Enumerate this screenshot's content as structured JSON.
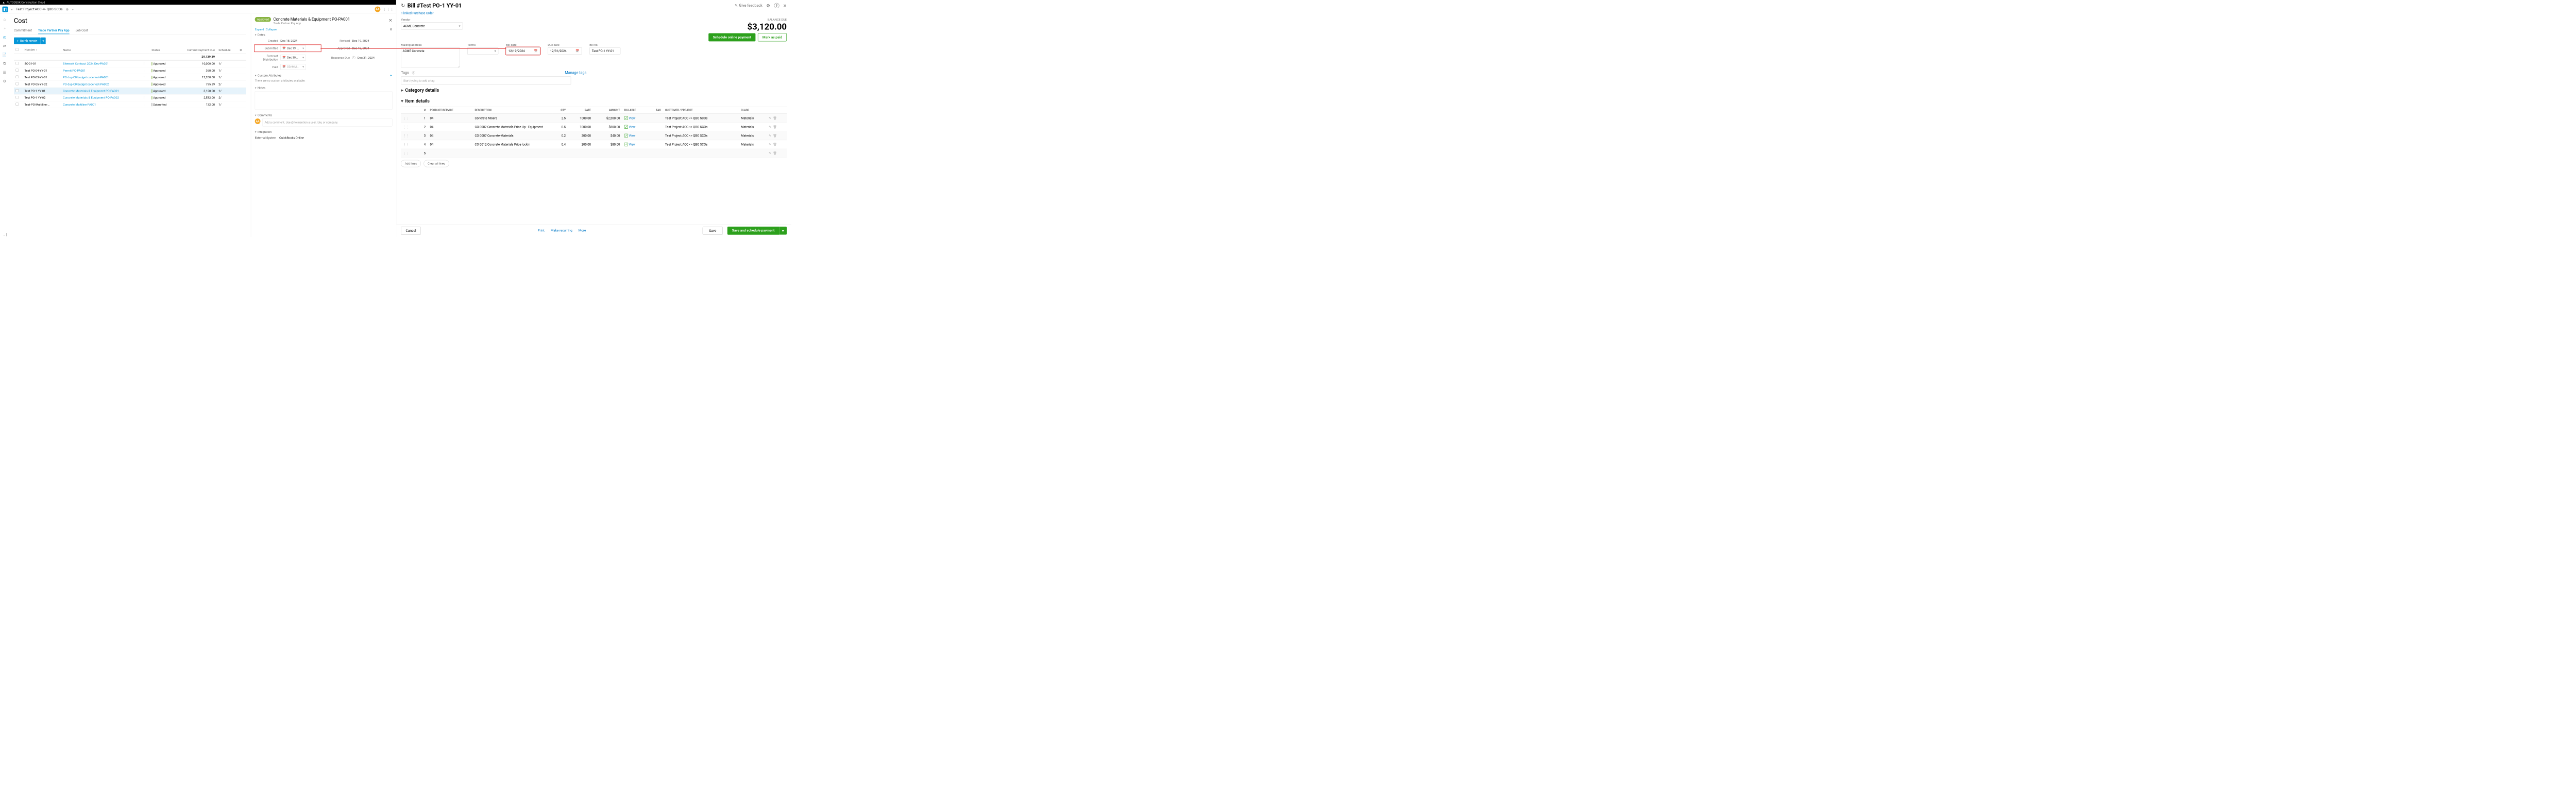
{
  "autodesk": {
    "brand": "AUTODESK Construction Cloud",
    "project_name": "Test Project:ACC <> QBO SCOs",
    "avatar": "AA",
    "page_title": "Cost",
    "tabs": [
      "Commitment",
      "Trade Partner Pay App",
      "Job Cost"
    ],
    "active_tab": 1,
    "batch_create_btn": "Batch create",
    "columns": {
      "number": "Number",
      "name": "Name",
      "status": "Status",
      "current_payment_due": "Current Payment Due",
      "schedule": "Schedule"
    },
    "total_due": "29,139.39",
    "rows": [
      {
        "num": "SC-01-01",
        "name": "Sitework Contract 2024 Dec-PA001",
        "status": "Approved",
        "due": "10,000.00",
        "sched": "1/"
      },
      {
        "num": "Test PO-04-YY-01",
        "name": "Permit PO-PA001",
        "status": "Approved",
        "due": "360.00",
        "sched": "1/"
      },
      {
        "num": "Test PO-05-YY-01",
        "name": "PO dup C0 budget code test-PA001",
        "status": "Approved",
        "due": "12,200.00",
        "sched": "1/"
      },
      {
        "num": "Test PO-05-YY-02",
        "name": "PO dup C0 budget code test-PA002",
        "status": "Approved",
        "due": "795.39",
        "sched": "2/"
      },
      {
        "num": "Test PO-1 YY-01",
        "name": "Concrete Materials & Equipment PO-PA001",
        "status": "Approved",
        "due": "3,120.00",
        "sched": "1/",
        "selected": true
      },
      {
        "num": "Test PO-1 YY-02",
        "name": "Concrete Materials & Equipment PO-PA002",
        "status": "Approved",
        "due": "2,532.00",
        "sched": "2/"
      },
      {
        "num": "Test-PO-Multiline-…",
        "name": "Concrete Multiline-PA001",
        "status": "Submitted",
        "due": "132.00",
        "sched": "1/"
      }
    ],
    "details": {
      "status_pill": "Approved",
      "title": "Concrete Materials & Equipment PO-PA001",
      "subtitle": "Trade Partner Pay App",
      "expand": "Expand",
      "collapse": "Collapse",
      "sections": {
        "dates": "Dates",
        "custom_attrs": "Custom Attributes",
        "notes": "Notes",
        "comments": "Comments",
        "integration": "Integration"
      },
      "dates": {
        "created_lbl": "Created",
        "created_val": "Dec 18, 2024",
        "revised_lbl": "Revised",
        "revised_val": "Dec 19, 2024",
        "submitted_lbl": "Submitted",
        "submitted_val": "Dec 19, …",
        "approved_lbl": "Approved",
        "approved_val": "Dec 18, 2024",
        "forecast_lbl": "Forecast Distribution",
        "forecast_val": "Dec 30,…",
        "response_due_lbl": "Response Due",
        "response_due_val": "Dec 31, 2024",
        "paid_lbl": "Paid",
        "paid_placeholder": "DD/MM…"
      },
      "custom_attrs_empty": "There are no custom attributes available.",
      "comment_placeholder": "Add a comment. Use @ to mention a user, role, or company.",
      "integration_system_lbl": "External System",
      "integration_system_val": "QuickBooks Online"
    }
  },
  "qb": {
    "title": "Bill #Test PO-1 YY-01",
    "give_feedback": "Give feedback",
    "linked_po": "1 linked Purchase Order",
    "vendor_lbl": "Vendor",
    "vendor_val": "ACME Concrete",
    "balance_due_lbl": "BALANCE DUE",
    "balance_due_val": "$3,120.00",
    "schedule_btn": "Schedule online payment",
    "mark_paid_btn": "Mark as paid",
    "mailing_lbl": "Mailing address",
    "mailing_val": "ACME Concrete",
    "terms_lbl": "Terms",
    "bill_date_lbl": "Bill date",
    "bill_date_val": "12/19/2024",
    "due_date_lbl": "Due date",
    "due_date_val": "12/31/2024",
    "bill_no_lbl": "Bill no.",
    "bill_no_val": "Test PO-1 YY-01",
    "tags_lbl": "Tags",
    "tags_placeholder": "Start typing to add a tag",
    "manage_tags": "Manage tags",
    "category_details": "Category details",
    "item_details": "Item details",
    "line_cols": {
      "num": "#",
      "product": "PRODUCT/SERVICE",
      "desc": "DESCRIPTION",
      "qty": "QTY",
      "rate": "RATE",
      "amount": "AMOUNT",
      "billable": "BILLABLE",
      "tax": "TAX",
      "customer": "CUSTOMER / PROJECT",
      "class": "CLASS"
    },
    "lines": [
      {
        "n": "1",
        "prod": "04",
        "desc": "Concrete Mixers",
        "qty": "2.5",
        "rate": "1000.00",
        "amount": "$2,500.00",
        "cust": "Test Project:ACC <> QBO SCOs",
        "cls": "Materials"
      },
      {
        "n": "2",
        "prod": "04",
        "desc": "CO 0002 Concrete Materials Price Up - Equipment",
        "qty": "0.5",
        "rate": "1000.00",
        "amount": "$500.00",
        "cust": "Test Project:ACC <> QBO SCOs",
        "cls": "Materials"
      },
      {
        "n": "3",
        "prod": "04",
        "desc": "CO 0007 Concrete-Materials",
        "qty": "0.2",
        "rate": "200.00",
        "amount": "$40.00",
        "cust": "Test Project:ACC <> QBO SCOs",
        "cls": "Materials"
      },
      {
        "n": "4",
        "prod": "04",
        "desc": "CO 0012 Concrete Materials Price lockin",
        "qty": "0.4",
        "rate": "200.00",
        "amount": "$80.00",
        "cust": "Test Project:ACC <> QBO SCOs",
        "cls": "Materials"
      },
      {
        "n": "5",
        "prod": "",
        "desc": "",
        "qty": "",
        "rate": "",
        "amount": "",
        "cust": "",
        "cls": ""
      }
    ],
    "view_lbl": "View",
    "add_lines": "Add lines",
    "clear_lines": "Clear all lines",
    "cancel": "Cancel",
    "print": "Print",
    "make_recurring": "Make recurring",
    "more": "More",
    "save": "Save",
    "save_schedule": "Save and schedule payment"
  }
}
